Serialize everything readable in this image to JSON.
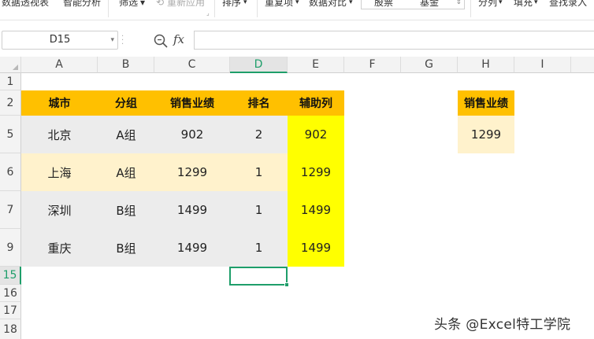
{
  "ribbon": {
    "items": [
      "数据透视表",
      "智能分析",
      "筛选",
      "重新应用",
      "排序",
      "重复项",
      "数据对比",
      "股票",
      "基金",
      "分列",
      "填充",
      "查找录入"
    ]
  },
  "formula_bar": {
    "name_box": "D15",
    "formula": ""
  },
  "sheet": {
    "columns": [
      "A",
      "B",
      "C",
      "D",
      "E",
      "F",
      "G",
      "H",
      "I"
    ],
    "rows": [
      "1",
      "2",
      "5",
      "6",
      "7",
      "9",
      "15",
      "16",
      "17",
      "18"
    ],
    "selected_column": "D",
    "selected_row": "15",
    "table_headers": [
      "城市",
      "分组",
      "销售业绩",
      "排名",
      "辅助列"
    ],
    "table_rows": [
      [
        "北京",
        "A组",
        "902",
        "2",
        "902"
      ],
      [
        "上海",
        "A组",
        "1299",
        "1",
        "1299"
      ],
      [
        "深圳",
        "B组",
        "1499",
        "1",
        "1499"
      ],
      [
        "重庆",
        "B组",
        "1499",
        "1",
        "1499"
      ]
    ],
    "side_header": "销售业绩",
    "side_value": "1299"
  },
  "watermark": "头条 @Excel特工学院",
  "colors": {
    "header_orange": "#ffc000",
    "row_gray": "#ececec",
    "row_cream": "#fff2cc",
    "helper_yellow": "#ffff00",
    "selection_green": "#1e9e6a"
  }
}
